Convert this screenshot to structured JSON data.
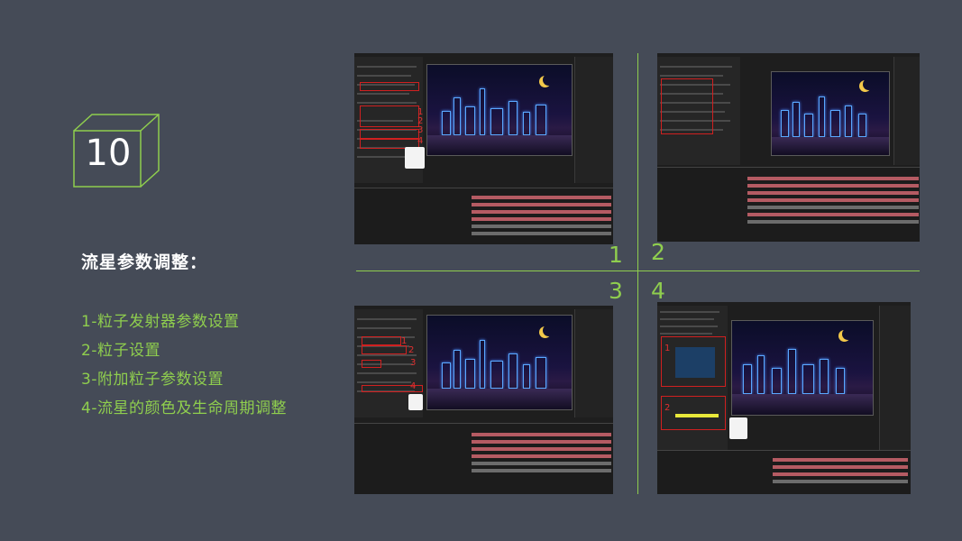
{
  "slide": {
    "number": "10",
    "heading": "流星参数调整：",
    "steps": [
      "1-粒子发射器参数设置",
      "2-粒子设置",
      "3-附加粒子参数设置",
      "4-流星的颜色及生命周期调整"
    ],
    "quadrant_labels": [
      "1",
      "2",
      "3",
      "4"
    ],
    "colors": {
      "background": "#454b57",
      "accent": "#8fce4e",
      "heading": "#ffffff"
    }
  },
  "screenshots": [
    {
      "name": "effect-controls-emitter",
      "annotations": [
        "1",
        "2",
        "3",
        "4"
      ]
    },
    {
      "name": "effect-controls-particle",
      "annotations": []
    },
    {
      "name": "effect-controls-auxiliary",
      "annotations": [
        "1",
        "2",
        "3",
        "4"
      ]
    },
    {
      "name": "effect-controls-color-life",
      "annotations": [
        "1",
        "2"
      ]
    }
  ]
}
